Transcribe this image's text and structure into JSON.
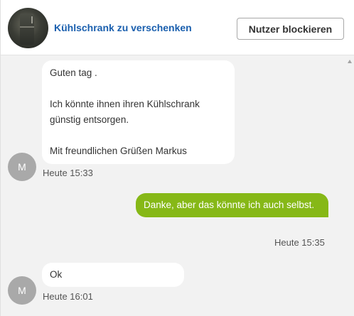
{
  "header": {
    "listing_title": "Kühlschrank zu verschenken",
    "block_button_label": "Nutzer blockieren"
  },
  "messages": [
    {
      "direction": "incoming",
      "text": "Guten tag .\n\nIch könnte ihnen ihren Kühlschrank günstig entsorgen.\n\nMit freundlichen Grüßen Markus",
      "avatar_initial": "M",
      "time": "Heute 15:33"
    },
    {
      "direction": "outgoing",
      "text": "Danke, aber das könnte ich auch selbst.",
      "time": "Heute 15:35"
    },
    {
      "direction": "incoming",
      "text": "Ok",
      "avatar_initial": "M",
      "time": "Heute 16:01"
    }
  ],
  "colors": {
    "outgoing_bubble": "#86b817",
    "incoming_bubble": "#ffffff",
    "title_link": "#1a5fae",
    "avatar": "#a9a9a9",
    "chat_background": "#f2f2f2"
  },
  "icons": {
    "scroll_up": "triangle-up-icon"
  }
}
